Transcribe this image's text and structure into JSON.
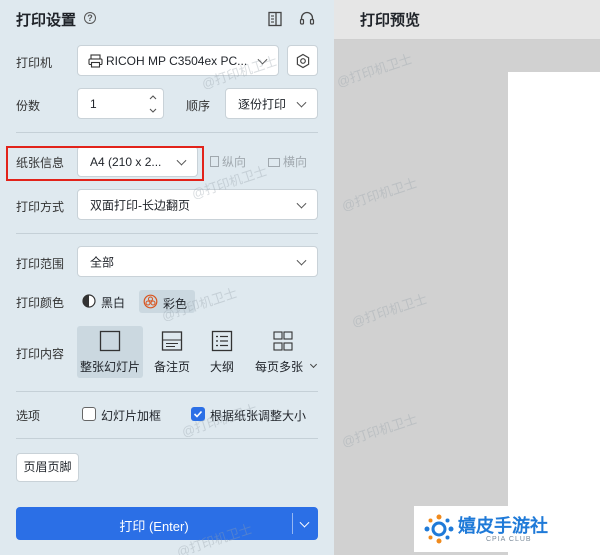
{
  "settings": {
    "title": "打印设置",
    "help_glyph": "?",
    "printer": {
      "label": "打印机",
      "value": "RICOH MP C3504ex PC..."
    },
    "copies": {
      "label": "份数",
      "value": "1"
    },
    "order": {
      "label": "顺序",
      "value": "逐份打印"
    },
    "paper": {
      "label": "纸张信息",
      "value": "A4 (210 x 2...",
      "portrait": "纵向",
      "landscape": "横向"
    },
    "mode": {
      "label": "打印方式",
      "value": "双面打印-长边翻页"
    },
    "range": {
      "label": "打印范围",
      "value": "全部"
    },
    "color": {
      "label": "打印颜色",
      "bw": "黑白",
      "color": "彩色",
      "selected": "彩色"
    },
    "content": {
      "label": "打印内容",
      "options": [
        "整张幻灯片",
        "备注页",
        "大纲",
        "每页多张"
      ],
      "selected": "整张幻灯片"
    },
    "options": {
      "label": "选项",
      "frame": "幻灯片加框",
      "frame_checked": false,
      "fit": "根据纸张调整大小",
      "fit_checked": true
    },
    "header_footer": "页眉页脚",
    "print_button": "打印 (Enter)"
  },
  "preview": {
    "title": "打印预览"
  },
  "watermark": "@打印机卫士",
  "logo": {
    "text": "嬉皮手游社",
    "sub": "CPIA CLUB"
  },
  "colors": {
    "accent": "#2b6fe6",
    "highlight": "#e2231a",
    "panel": "#dfe9ef"
  },
  "icons": [
    "help-icon",
    "panel-icon",
    "headset-icon",
    "printer-icon",
    "settings-icon",
    "chevron-down-icon",
    "portrait-page-icon",
    "landscape-page-icon",
    "bw-icon",
    "color-palette-icon",
    "slide-icon",
    "notes-icon",
    "outline-icon",
    "multi-page-icon",
    "checkbox-icon"
  ]
}
